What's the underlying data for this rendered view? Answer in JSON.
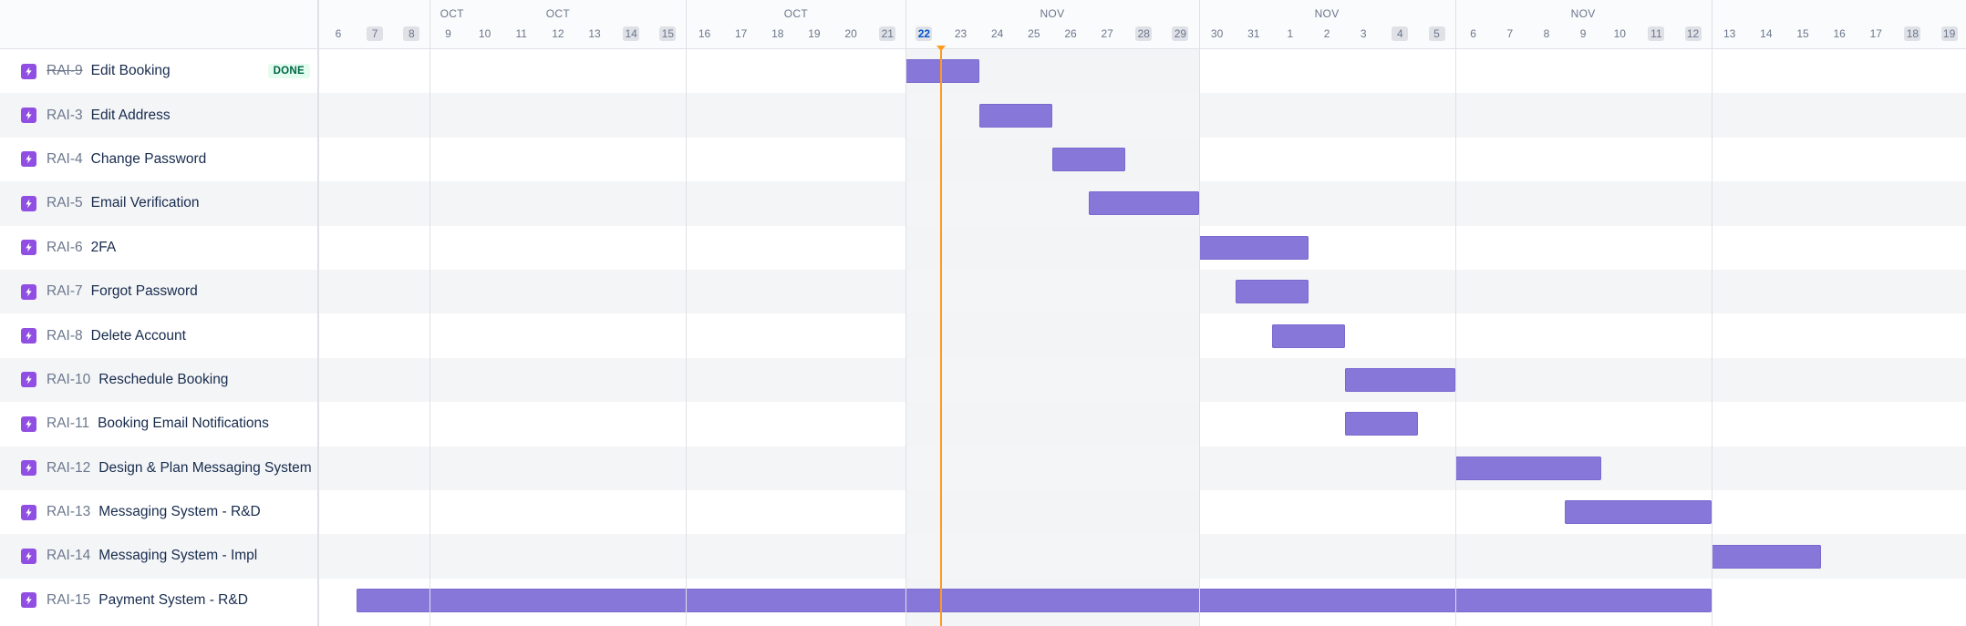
{
  "colors": {
    "bar": "#8777d9",
    "today_line": "#ff991f",
    "issue_type": "#904ee2",
    "done_lozenge_bg": "#e3fcef",
    "done_lozenge_text": "#006644"
  },
  "timeline": {
    "months": [
      {
        "label": "OCT"
      },
      {
        "label": "OCT"
      },
      {
        "label": "OCT"
      },
      {
        "label": "NOV"
      },
      {
        "label": "NOV"
      },
      {
        "label": "NOV"
      }
    ],
    "days": [
      {
        "label": "6"
      },
      {
        "label": "7",
        "weekend": true
      },
      {
        "label": "8",
        "weekend": true
      },
      {
        "label": "9"
      },
      {
        "label": "10"
      },
      {
        "label": "11"
      },
      {
        "label": "12"
      },
      {
        "label": "13"
      },
      {
        "label": "14",
        "weekend": true
      },
      {
        "label": "15",
        "weekend": true
      },
      {
        "label": "16"
      },
      {
        "label": "17"
      },
      {
        "label": "18"
      },
      {
        "label": "19"
      },
      {
        "label": "20"
      },
      {
        "label": "21",
        "weekend": true
      },
      {
        "label": "22",
        "today": true
      },
      {
        "label": "23"
      },
      {
        "label": "24"
      },
      {
        "label": "25"
      },
      {
        "label": "26"
      },
      {
        "label": "27"
      },
      {
        "label": "28",
        "weekend": true
      },
      {
        "label": "29",
        "weekend": true
      },
      {
        "label": "30"
      },
      {
        "label": "31"
      },
      {
        "label": "1"
      },
      {
        "label": "2"
      },
      {
        "label": "3"
      },
      {
        "label": "4",
        "weekend": true
      },
      {
        "label": "5",
        "weekend": true
      },
      {
        "label": "6"
      },
      {
        "label": "7"
      },
      {
        "label": "8"
      },
      {
        "label": "9"
      },
      {
        "label": "10"
      },
      {
        "label": "11",
        "weekend": true
      },
      {
        "label": "12",
        "weekend": true
      },
      {
        "label": "13"
      },
      {
        "label": "14"
      },
      {
        "label": "15"
      },
      {
        "label": "16"
      },
      {
        "label": "17"
      },
      {
        "label": "18",
        "weekend": true
      },
      {
        "label": "19",
        "weekend": true
      }
    ]
  },
  "issues": [
    {
      "key": "RAI-9",
      "summary": "Edit Booking",
      "status": "DONE",
      "done": true,
      "icon": "story-icon",
      "start": "Oct 22",
      "end": "Oct 23"
    },
    {
      "key": "RAI-3",
      "summary": "Edit Address",
      "icon": "story-icon",
      "start": "Oct 24",
      "end": "Oct 25"
    },
    {
      "key": "RAI-4",
      "summary": "Change Password",
      "icon": "story-icon",
      "start": "Oct 26",
      "end": "Oct 27"
    },
    {
      "key": "RAI-5",
      "summary": "Email Verification",
      "icon": "story-icon",
      "start": "Oct 27",
      "end": "Oct 29"
    },
    {
      "key": "RAI-6",
      "summary": "2FA",
      "icon": "story-icon",
      "start": "Oct 30",
      "end": "Nov 1"
    },
    {
      "key": "RAI-7",
      "summary": "Forgot Password",
      "icon": "story-icon",
      "start": "Oct 31",
      "end": "Nov 1"
    },
    {
      "key": "RAI-8",
      "summary": "Delete Account",
      "icon": "story-icon",
      "start": "Nov 1",
      "end": "Nov 2"
    },
    {
      "key": "RAI-10",
      "summary": "Reschedule Booking",
      "icon": "story-icon",
      "start": "Nov 3",
      "end": "Nov 5"
    },
    {
      "key": "RAI-11",
      "summary": "Booking Email Notifications",
      "icon": "story-icon",
      "start": "Nov 3",
      "end": "Nov 4"
    },
    {
      "key": "RAI-12",
      "summary": "Design & Plan Messaging System",
      "icon": "story-icon",
      "start": "Nov 6",
      "end": "Nov 9"
    },
    {
      "key": "RAI-13",
      "summary": "Messaging System - R&D",
      "icon": "story-icon",
      "start": "Nov 9",
      "end": "Nov 12"
    },
    {
      "key": "RAI-14",
      "summary": "Messaging System - Impl",
      "icon": "story-icon",
      "start": "Nov 13",
      "end": "Nov 15"
    },
    {
      "key": "RAI-15",
      "summary": "Payment System - R&D",
      "icon": "story-icon",
      "start": "Oct 7",
      "end": "Nov 12"
    }
  ]
}
